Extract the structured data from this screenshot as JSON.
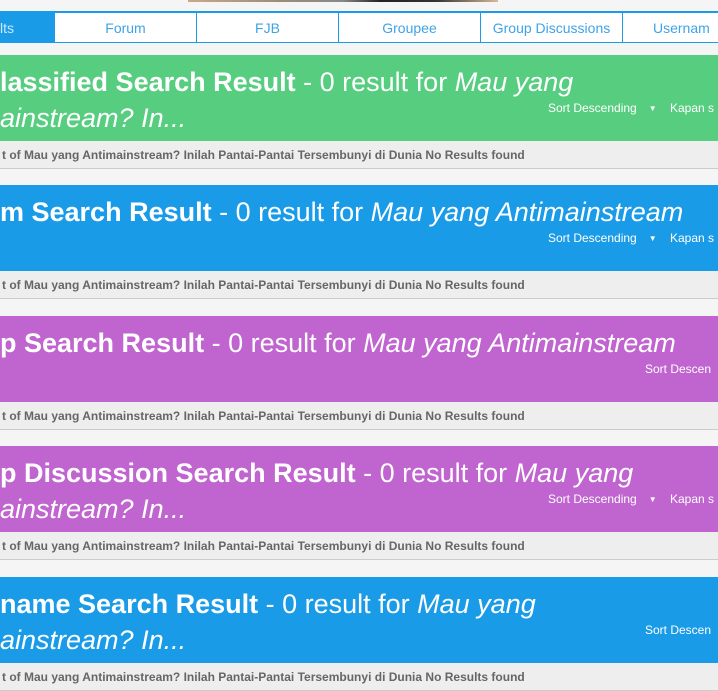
{
  "nav": {
    "tabs": [
      {
        "label": "lts",
        "active": true
      },
      {
        "label": "Forum"
      },
      {
        "label": "FJB"
      },
      {
        "label": "Groupee"
      },
      {
        "label": "Group Discussions"
      },
      {
        "label": "Usernam"
      }
    ]
  },
  "colors": {
    "classified": "#57cd80",
    "forum": "#1a9be8",
    "group": "#c064cf",
    "group_discussion": "#c064cf",
    "username": "#1a9be8"
  },
  "sections": [
    {
      "title": "lassified Search Result",
      "line1_rest": " - 0 result for ",
      "line1_query": "Mau yang",
      "line2_query": "ainstream? In...",
      "sort": "Sort Descending",
      "sort2": "Kapan s",
      "subtitle": "t of Mau yang Antimainstream? Inilah Pantai-Pantai Tersembunyi di Dunia No Results found"
    },
    {
      "title": "m Search Result",
      "line1_rest": " - 0 result for ",
      "line1_query": "Mau yang Antimainstream",
      "line2_query": "",
      "sort": "Sort Descending",
      "sort2": "Kapan s",
      "subtitle": "t of Mau yang Antimainstream? Inilah Pantai-Pantai Tersembunyi di Dunia No Results found"
    },
    {
      "title": "p Search Result",
      "line1_rest": " - 0 result for ",
      "line1_query": "Mau yang Antimainstream",
      "line2_query": "",
      "sort": "Sort Descen",
      "sort2": "",
      "subtitle": "t of Mau yang Antimainstream? Inilah Pantai-Pantai Tersembunyi di Dunia No Results found"
    },
    {
      "title": "p Discussion Search Result",
      "line1_rest": " - 0 result for ",
      "line1_query": "Mau yang",
      "line2_query": "ainstream? In...",
      "sort": "Sort Descending",
      "sort2": "Kapan s",
      "subtitle": "t of Mau yang Antimainstream? Inilah Pantai-Pantai Tersembunyi di Dunia No Results found"
    },
    {
      "title": "name Search Result",
      "line1_rest": " - 0 result for ",
      "line1_query": "Mau yang",
      "line2_query": "ainstream? In...",
      "sort": "Sort Descen",
      "sort2": "",
      "subtitle": "t of Mau yang Antimainstream? Inilah Pantai-Pantai Tersembunyi di Dunia No Results found"
    }
  ]
}
